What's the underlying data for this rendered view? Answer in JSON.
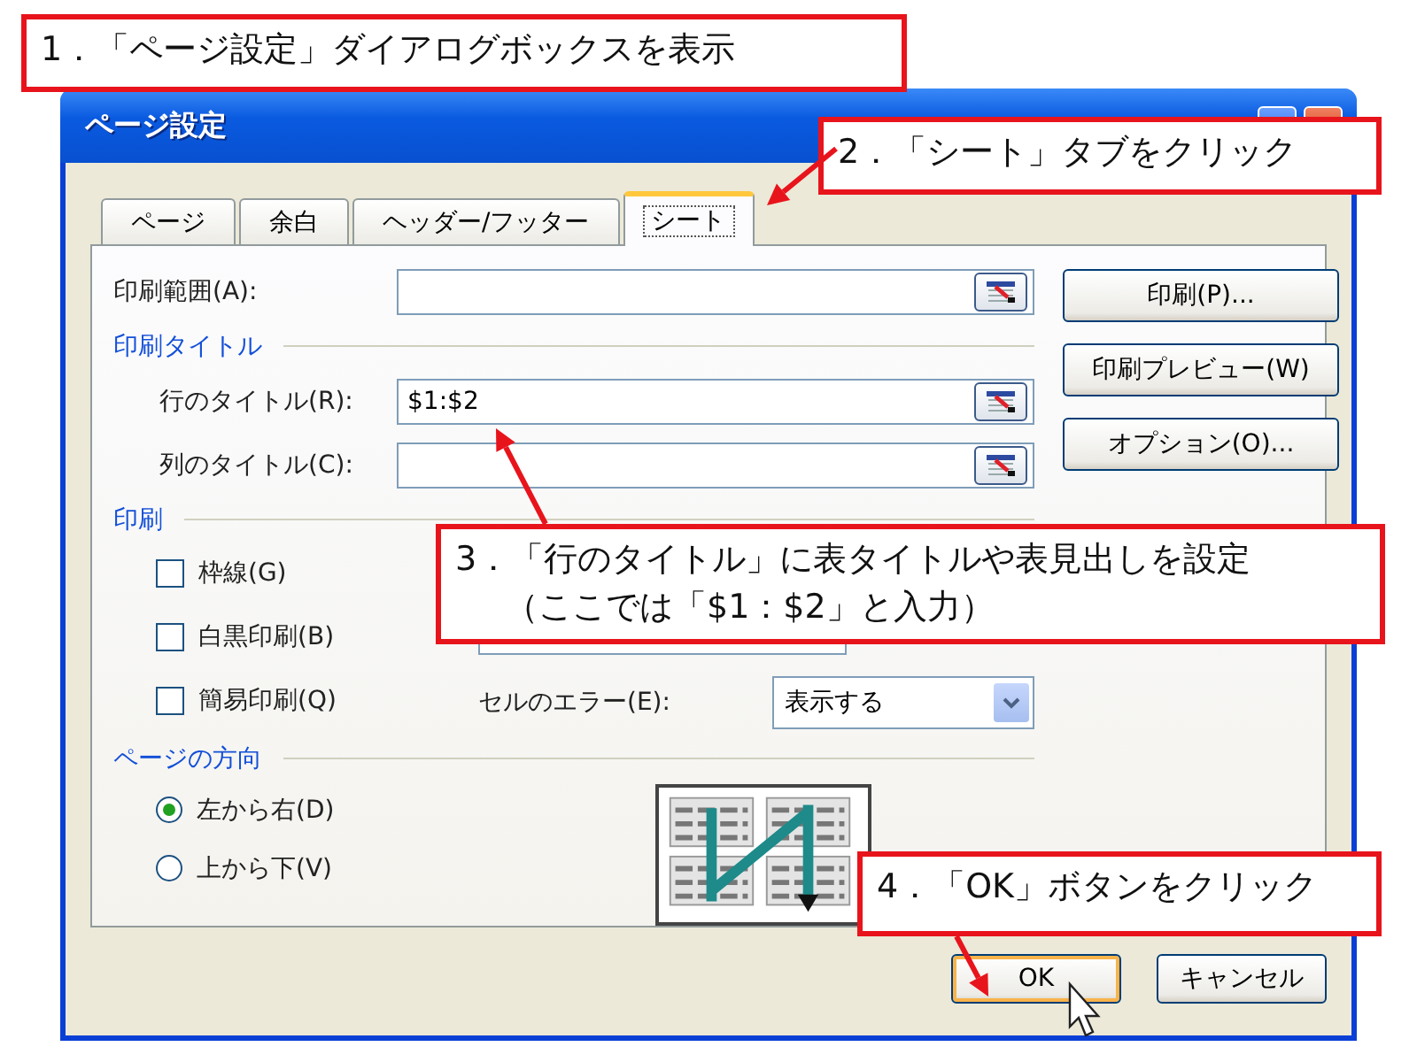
{
  "window": {
    "title": "ページ設定"
  },
  "tabs": [
    {
      "label": "ページ",
      "selected": false
    },
    {
      "label": "余白",
      "selected": false
    },
    {
      "label": "ヘッダー/フッター",
      "selected": false
    },
    {
      "label": "シート",
      "selected": true
    }
  ],
  "print_area": {
    "label": "印刷範囲(A):"
  },
  "print_titles": {
    "heading": "印刷タイトル",
    "fields": [
      {
        "label": "行のタイトル(R):",
        "value": "$1:$2"
      },
      {
        "label": "列のタイトル(C):"
      }
    ]
  },
  "print": {
    "heading": "印刷",
    "options": [
      {
        "label": "枠線(G)",
        "checked": false
      },
      {
        "label": "白黒印刷(B)",
        "checked": false
      },
      {
        "label": "簡易印刷(Q)",
        "checked": false
      }
    ],
    "cell_errors": {
      "label": "セルのエラー(E):",
      "value": "表示する"
    }
  },
  "orientation": {
    "heading": "ページの方向",
    "options": [
      {
        "label": "左から右(D)",
        "selected": true
      },
      {
        "label": "上から下(V)",
        "selected": false
      }
    ]
  },
  "side_buttons": [
    "印刷(P)...",
    "印刷プレビュー(W)",
    "オプション(O)..."
  ],
  "footer_buttons": [
    {
      "label": "OK",
      "kind": "default"
    },
    {
      "label": "キャンセル",
      "kind": "normal"
    }
  ],
  "annotations": [
    {
      "lines": [
        "1．「ページ設定」ダイアログボックスを表示"
      ]
    },
    {
      "lines": [
        "2．「シート」タブをクリック"
      ]
    },
    {
      "lines": [
        "3．「行のタイトル」に表タイトルや表見出しを設定",
        "（ここでは「$1：$2」と入力）"
      ]
    },
    {
      "lines": [
        "4．「OK」ボタンをクリック"
      ]
    }
  ]
}
